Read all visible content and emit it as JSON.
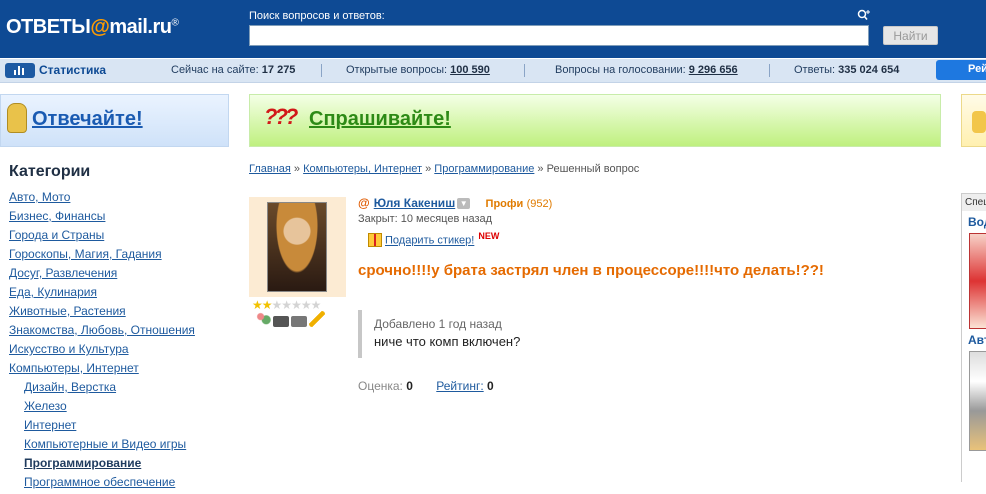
{
  "header": {
    "logo_main": "ОТВЕТЫ",
    "logo_at": "@",
    "logo_domain": "mail.ru",
    "logo_reg": "®",
    "search_label": "Поиск вопросов и ответов:",
    "search_value": "",
    "search_button": "Найти"
  },
  "stats": {
    "title": "Статистика",
    "online_label": "Сейчас на сайте:",
    "online_value": "17 275",
    "open_label": "Открытые вопросы:",
    "open_value": "100 590",
    "vote_label": "Вопросы на голосовании:",
    "vote_value": "9 296 656",
    "answers_label": "Ответы:",
    "answers_value": "335 024 654",
    "right_tab": "Рей"
  },
  "banners": {
    "answer": "Отвечайте!",
    "ask_qmarks": "???",
    "ask": "Спрашивайте!"
  },
  "sidebar": {
    "title": "Категории",
    "items": [
      {
        "label": "Авто, Мото",
        "sub": false
      },
      {
        "label": "Бизнес, Финансы",
        "sub": false
      },
      {
        "label": "Города и Страны",
        "sub": false
      },
      {
        "label": "Гороскопы, Магия, Гадания",
        "sub": false
      },
      {
        "label": "Досуг, Развлечения",
        "sub": false
      },
      {
        "label": "Еда, Кулинария",
        "sub": false
      },
      {
        "label": "Животные, Растения",
        "sub": false
      },
      {
        "label": "Знакомства, Любовь, Отношения",
        "sub": false
      },
      {
        "label": "Искусство и Культура",
        "sub": false
      },
      {
        "label": "Компьютеры, Интернет",
        "sub": false
      },
      {
        "label": "Дизайн, Верстка",
        "sub": true
      },
      {
        "label": "Железо",
        "sub": true
      },
      {
        "label": "Интернет",
        "sub": true
      },
      {
        "label": "Компьютерные и Видео игры",
        "sub": true
      },
      {
        "label": "Программирование",
        "sub": true,
        "active": true
      },
      {
        "label": "Программное обеспечение",
        "sub": true
      }
    ]
  },
  "breadcrumb": {
    "home": "Главная",
    "cat": "Компьютеры, Интернет",
    "subcat": "Программирование",
    "current": "Решенный вопрос",
    "sep": " » "
  },
  "question": {
    "user_name": "Юля Какениш",
    "rank": "Профи",
    "points": "(952)",
    "closed": "Закрыт: 10 месяцев назад",
    "gift": "Подарить стикер!",
    "gift_new": "NEW",
    "title": "срочно!!!!у брата застрял член в процессоре!!!!что делать!??!",
    "added_when": "Добавлено 1 год назад",
    "added_text": "ниче что комп включен?",
    "score_label": "Оценка:",
    "score_value": "0",
    "rating_label": "Рейтинг:",
    "rating_value": "0",
    "stars_filled": 2,
    "stars_total": 7
  },
  "right_col": {
    "header": "Спец",
    "link1": "Вод",
    "link2": "Авт"
  },
  "colors": {
    "header_bg": "#0e4a94",
    "accent_orange": "#e56a00",
    "link": "#1e5a9e",
    "ask_green": "#2d8a16"
  }
}
